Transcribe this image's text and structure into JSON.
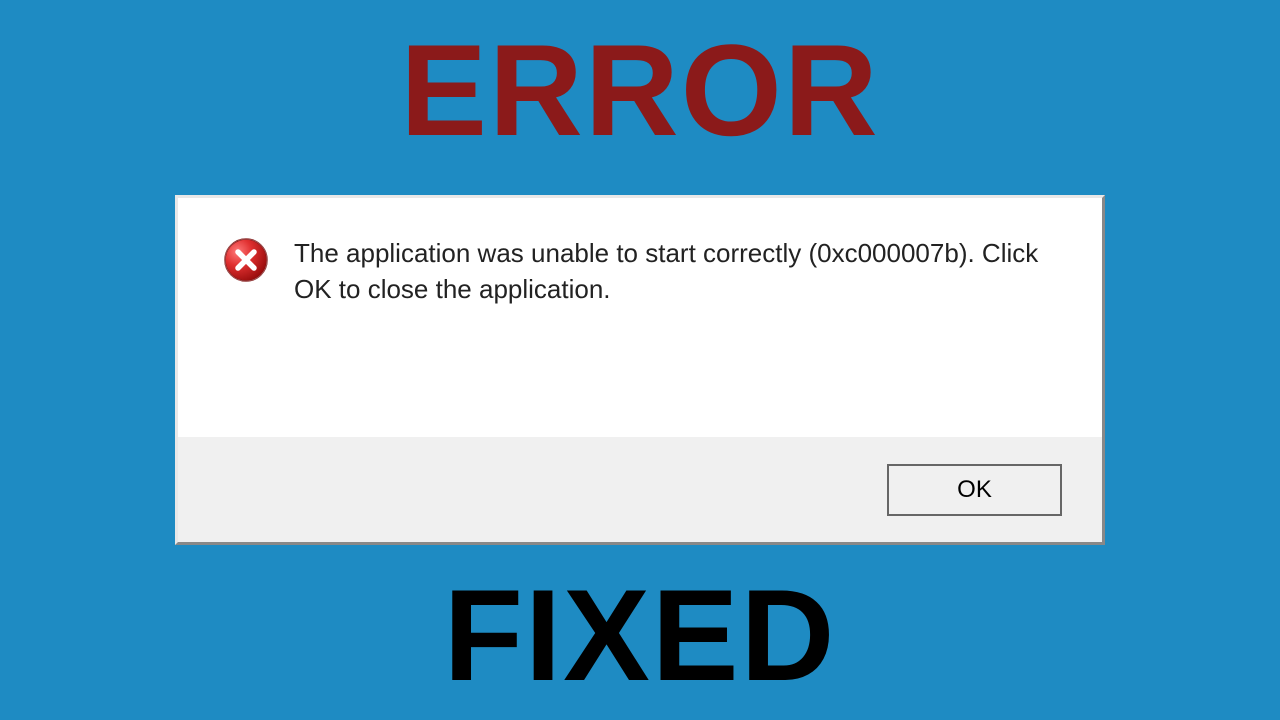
{
  "headings": {
    "top": "ERROR",
    "bottom": "FIXED"
  },
  "dialog": {
    "message": "The application was unable to start correctly (0xc000007b). Click OK to close the application.",
    "ok_label": "OK",
    "icon": "error-icon"
  },
  "colors": {
    "background": "#1e8bc3",
    "top_heading": "#8b1a1a",
    "bottom_heading": "#000000"
  }
}
